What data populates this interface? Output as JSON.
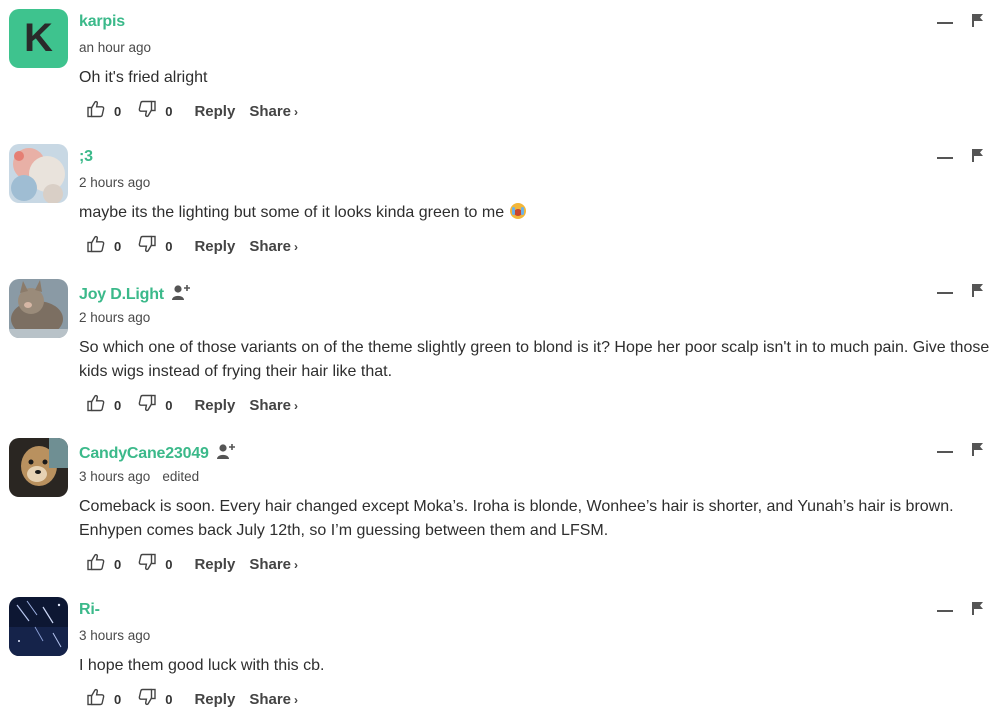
{
  "comments": [
    {
      "username": "karpis",
      "time": "an hour ago",
      "edited": "",
      "text": "Oh it's fried alright",
      "emoji": "",
      "avatar_letter": "K",
      "avatar_color": "#3ec38e",
      "likes": "0",
      "dislikes": "0"
    },
    {
      "username": ";3",
      "time": "2 hours ago",
      "edited": "",
      "text": "maybe its the lighting but some of it looks kinda green to me",
      "emoji": "crying-face-emoji",
      "avatar_letter": "",
      "likes": "0",
      "dislikes": "0"
    },
    {
      "username": "Joy D.Light",
      "time": "2 hours ago",
      "edited": "",
      "text": "So which one of those variants on of the theme slightly green to blond is it? Hope her poor scalp isn't in to much pain. Give those kids wigs instead of frying their hair like that.",
      "emoji": "",
      "avatar_letter": "",
      "likes": "0",
      "dislikes": "0"
    },
    {
      "username": "CandyCane23049",
      "time": "3 hours ago",
      "edited": "edited",
      "text": "Comeback is soon. Every hair changed except Moka’s. Iroha is blonde, Wonhee’s hair is shorter, and Yunah’s hair is brown. Enhypen comes back July 12th, so I’m guessing between them and LFSM.",
      "emoji": "",
      "avatar_letter": "",
      "likes": "0",
      "dislikes": "0"
    },
    {
      "username": "Ri-",
      "time": "3 hours ago",
      "edited": "",
      "text": "I hope them good luck with this cb.",
      "emoji": "",
      "avatar_letter": "",
      "likes": "0",
      "dislikes": "0"
    }
  ],
  "actions": {
    "reply_label": "Reply",
    "share_label": "Share",
    "share_chevron": "›"
  },
  "colors": {
    "username": "#3bb98a",
    "text": "#2e2e2e",
    "accent_avatar": "#3ec38e"
  }
}
